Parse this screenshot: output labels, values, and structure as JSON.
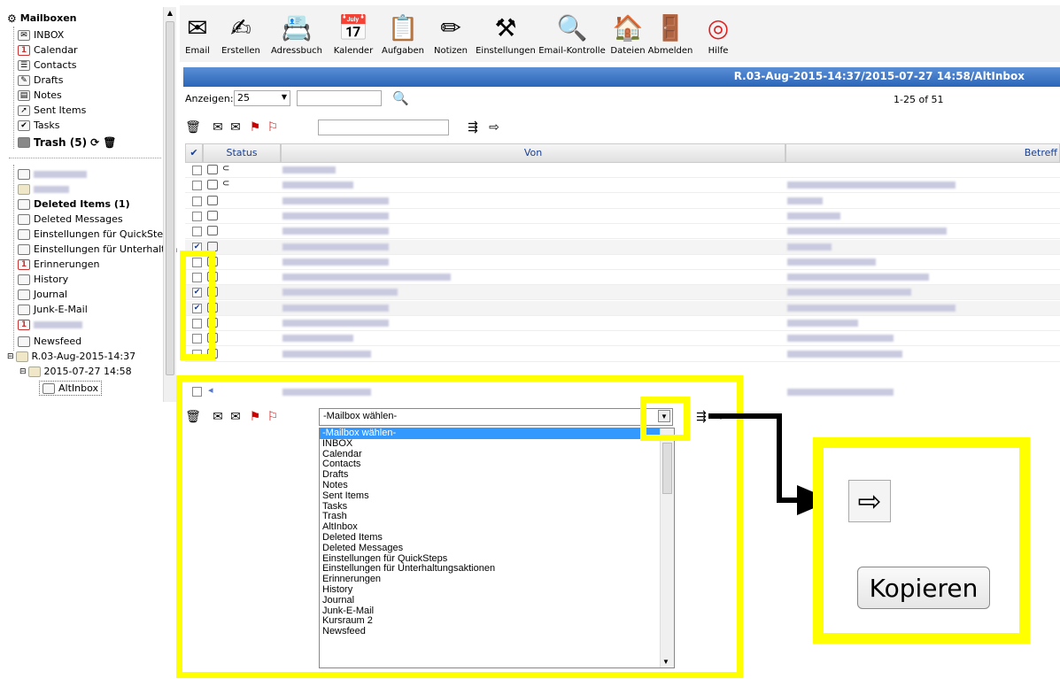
{
  "sidebar": {
    "root": "Mailboxen",
    "items": [
      {
        "label": "INBOX",
        "icon": "inbox-icon"
      },
      {
        "label": "Calendar",
        "icon": "calendar-icon"
      },
      {
        "label": "Contacts",
        "icon": "contacts-icon"
      },
      {
        "label": "Drafts",
        "icon": "drafts-icon"
      },
      {
        "label": "Notes",
        "icon": "notes-icon"
      },
      {
        "label": "Sent Items",
        "icon": "sent-icon"
      },
      {
        "label": "Tasks",
        "icon": "tasks-icon"
      },
      {
        "label": "Trash (5)",
        "icon": "trash-icon"
      }
    ],
    "folders": [
      {
        "label": "Deleted Items (1)"
      },
      {
        "label": "Deleted Messages"
      },
      {
        "label": "Einstellungen für QuickSteps"
      },
      {
        "label": "Einstellungen für Unterhaltung"
      },
      {
        "label": "Erinnerungen"
      },
      {
        "label": "History"
      },
      {
        "label": "Journal"
      },
      {
        "label": "Junk-E-Mail"
      },
      {
        "label": "Newsfeed"
      },
      {
        "label": "R.03-Aug-2015-14:37"
      },
      {
        "label": "2015-07-27 14:58"
      },
      {
        "label": "AltInbox"
      }
    ]
  },
  "toolbar": {
    "buttons": [
      {
        "label": "Email"
      },
      {
        "label": "Erstellen"
      },
      {
        "label": "Adressbuch"
      },
      {
        "label": "Kalender"
      },
      {
        "label": "Aufgaben"
      },
      {
        "label": "Notizen"
      },
      {
        "label": "Einstellungen"
      },
      {
        "label": "Email-Kontrolle"
      },
      {
        "label": "Dateien"
      },
      {
        "label": "Abmelden"
      },
      {
        "label": "Hilfe"
      }
    ]
  },
  "folder_bar": {
    "title": "R.03-Aug-2015-14:37/2015-07-27 14:58/AltInbox"
  },
  "list_controls": {
    "show_label": "Anzeigen:",
    "show_value": "25",
    "range": "1-25 of 51"
  },
  "table": {
    "headers": {
      "status": "Status",
      "von": "Von",
      "betreff": "Betreff"
    }
  },
  "mailbox_select": {
    "value": "-Mailbox wählen-",
    "options": [
      "-Mailbox wählen-",
      "INBOX",
      "Calendar",
      "Contacts",
      "Drafts",
      "Notes",
      "Sent Items",
      "Tasks",
      "Trash",
      "AltInbox",
      "Deleted Items",
      "Deleted Messages",
      "Einstellungen für QuickSteps",
      "Einstellungen für Unterhaltungsaktionen",
      "Erinnerungen",
      "History",
      "Journal",
      "Junk-E-Mail",
      "Kursraum 2",
      "Newsfeed"
    ]
  },
  "zoom": {
    "button_label": "Kopieren"
  },
  "colors": {
    "highlight": "#ffff00",
    "header_blue": "#2b65b8",
    "selection": "#3399ff"
  }
}
